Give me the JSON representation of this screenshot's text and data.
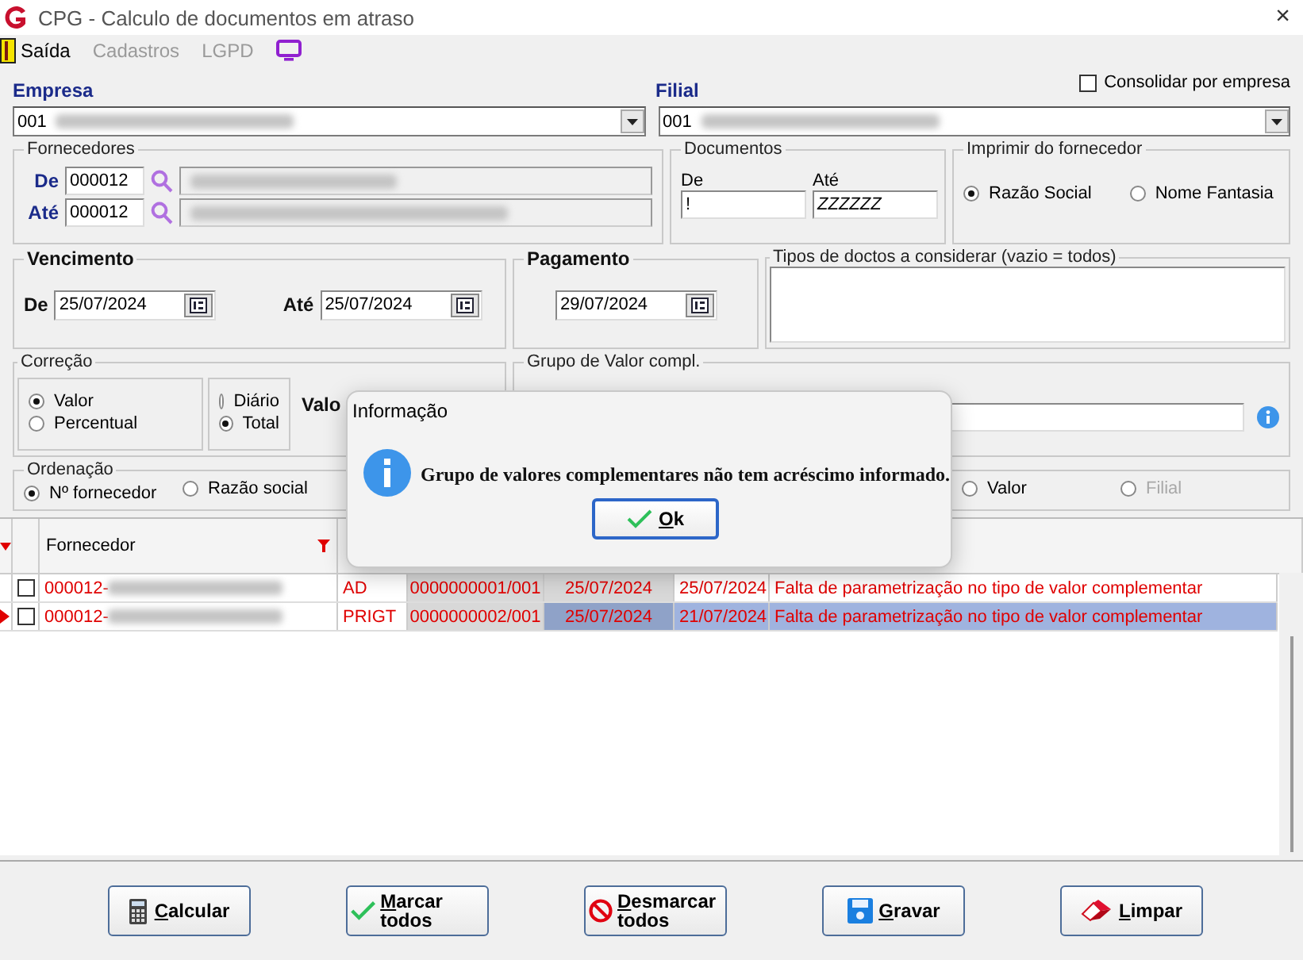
{
  "window": {
    "title": "CPG - Calculo de documentos em atraso",
    "close": "×"
  },
  "menu": [
    {
      "label": "Saída",
      "disabled": false
    },
    {
      "label": "Cadastros",
      "disabled": true
    },
    {
      "label": "LGPD",
      "disabled": true
    }
  ],
  "empresa": {
    "label": "Empresa",
    "value": "001"
  },
  "filial": {
    "label": "Filial",
    "value": "001"
  },
  "consolidar": {
    "label": "Consolidar por empresa",
    "checked": false
  },
  "fornecedores": {
    "title": "Fornecedores",
    "de_label": "De",
    "de_value": "000012",
    "ate_label": "Até",
    "ate_value": "000012"
  },
  "documentos": {
    "title": "Documentos",
    "de_label": "De",
    "de_value": "!",
    "ate_label": "Até",
    "ate_value": "ZZZZZZ"
  },
  "imprimir": {
    "title": "Imprimir do fornecedor",
    "options": [
      {
        "label": "Razão Social",
        "selected": true
      },
      {
        "label": "Nome Fantasia",
        "selected": false
      }
    ]
  },
  "vencimento": {
    "title": "Vencimento",
    "de_label": "De",
    "de_value": "25/07/2024",
    "ate_label": "Até",
    "ate_value": "25/07/2024"
  },
  "pagamento": {
    "title": "Pagamento",
    "value": "29/07/2024"
  },
  "tipos": {
    "title": "Tipos de doctos a considerar (vazio = todos)"
  },
  "correcao": {
    "title": "Correção",
    "tipo": [
      {
        "label": "Valor",
        "selected": true
      },
      {
        "label": "Percentual",
        "selected": false
      }
    ],
    "periodo": [
      {
        "label": "Diário",
        "selected": false
      },
      {
        "label": "Total",
        "selected": true
      }
    ],
    "valor_label": "Valo"
  },
  "grupo": {
    "title": "Grupo de Valor compl."
  },
  "ordenacao": {
    "title": "Ordenação",
    "options": [
      {
        "label": "Nº fornecedor",
        "selected": true,
        "disabled": false
      },
      {
        "label": "Razão social",
        "selected": false,
        "disabled": false
      },
      {
        "label": "Valor",
        "selected": false,
        "disabled": false
      },
      {
        "label": "Filial",
        "selected": false,
        "disabled": true
      }
    ]
  },
  "table": {
    "columns": [
      "Fornecedor"
    ],
    "rows": [
      {
        "selected": false,
        "checked": false,
        "code": "000012-",
        "tipo": "AD",
        "documento": "0000000001/001",
        "vencimento": "25/07/2024",
        "pagamento": "25/07/2024",
        "mensagem": "Falta de parametrização no tipo de valor complementar"
      },
      {
        "selected": true,
        "checked": false,
        "code": "000012-",
        "tipo": "PRIGT",
        "documento": "0000000002/001",
        "vencimento": "25/07/2024",
        "pagamento": "21/07/2024",
        "mensagem": "Falta de parametrização no tipo de valor complementar"
      }
    ]
  },
  "buttons": [
    {
      "label": "Calcular",
      "kind": "calculator"
    },
    {
      "label": "Marcar todos",
      "kind": "check"
    },
    {
      "label": "Desmarcar todos",
      "kind": "forbid"
    },
    {
      "label": "Gravar",
      "kind": "save"
    },
    {
      "label": "Limpar",
      "kind": "eraser"
    }
  ],
  "dialog": {
    "title": "Informação",
    "message": "Grupo de valores complementares não tem acréscimo informado.",
    "button": "Ok"
  }
}
